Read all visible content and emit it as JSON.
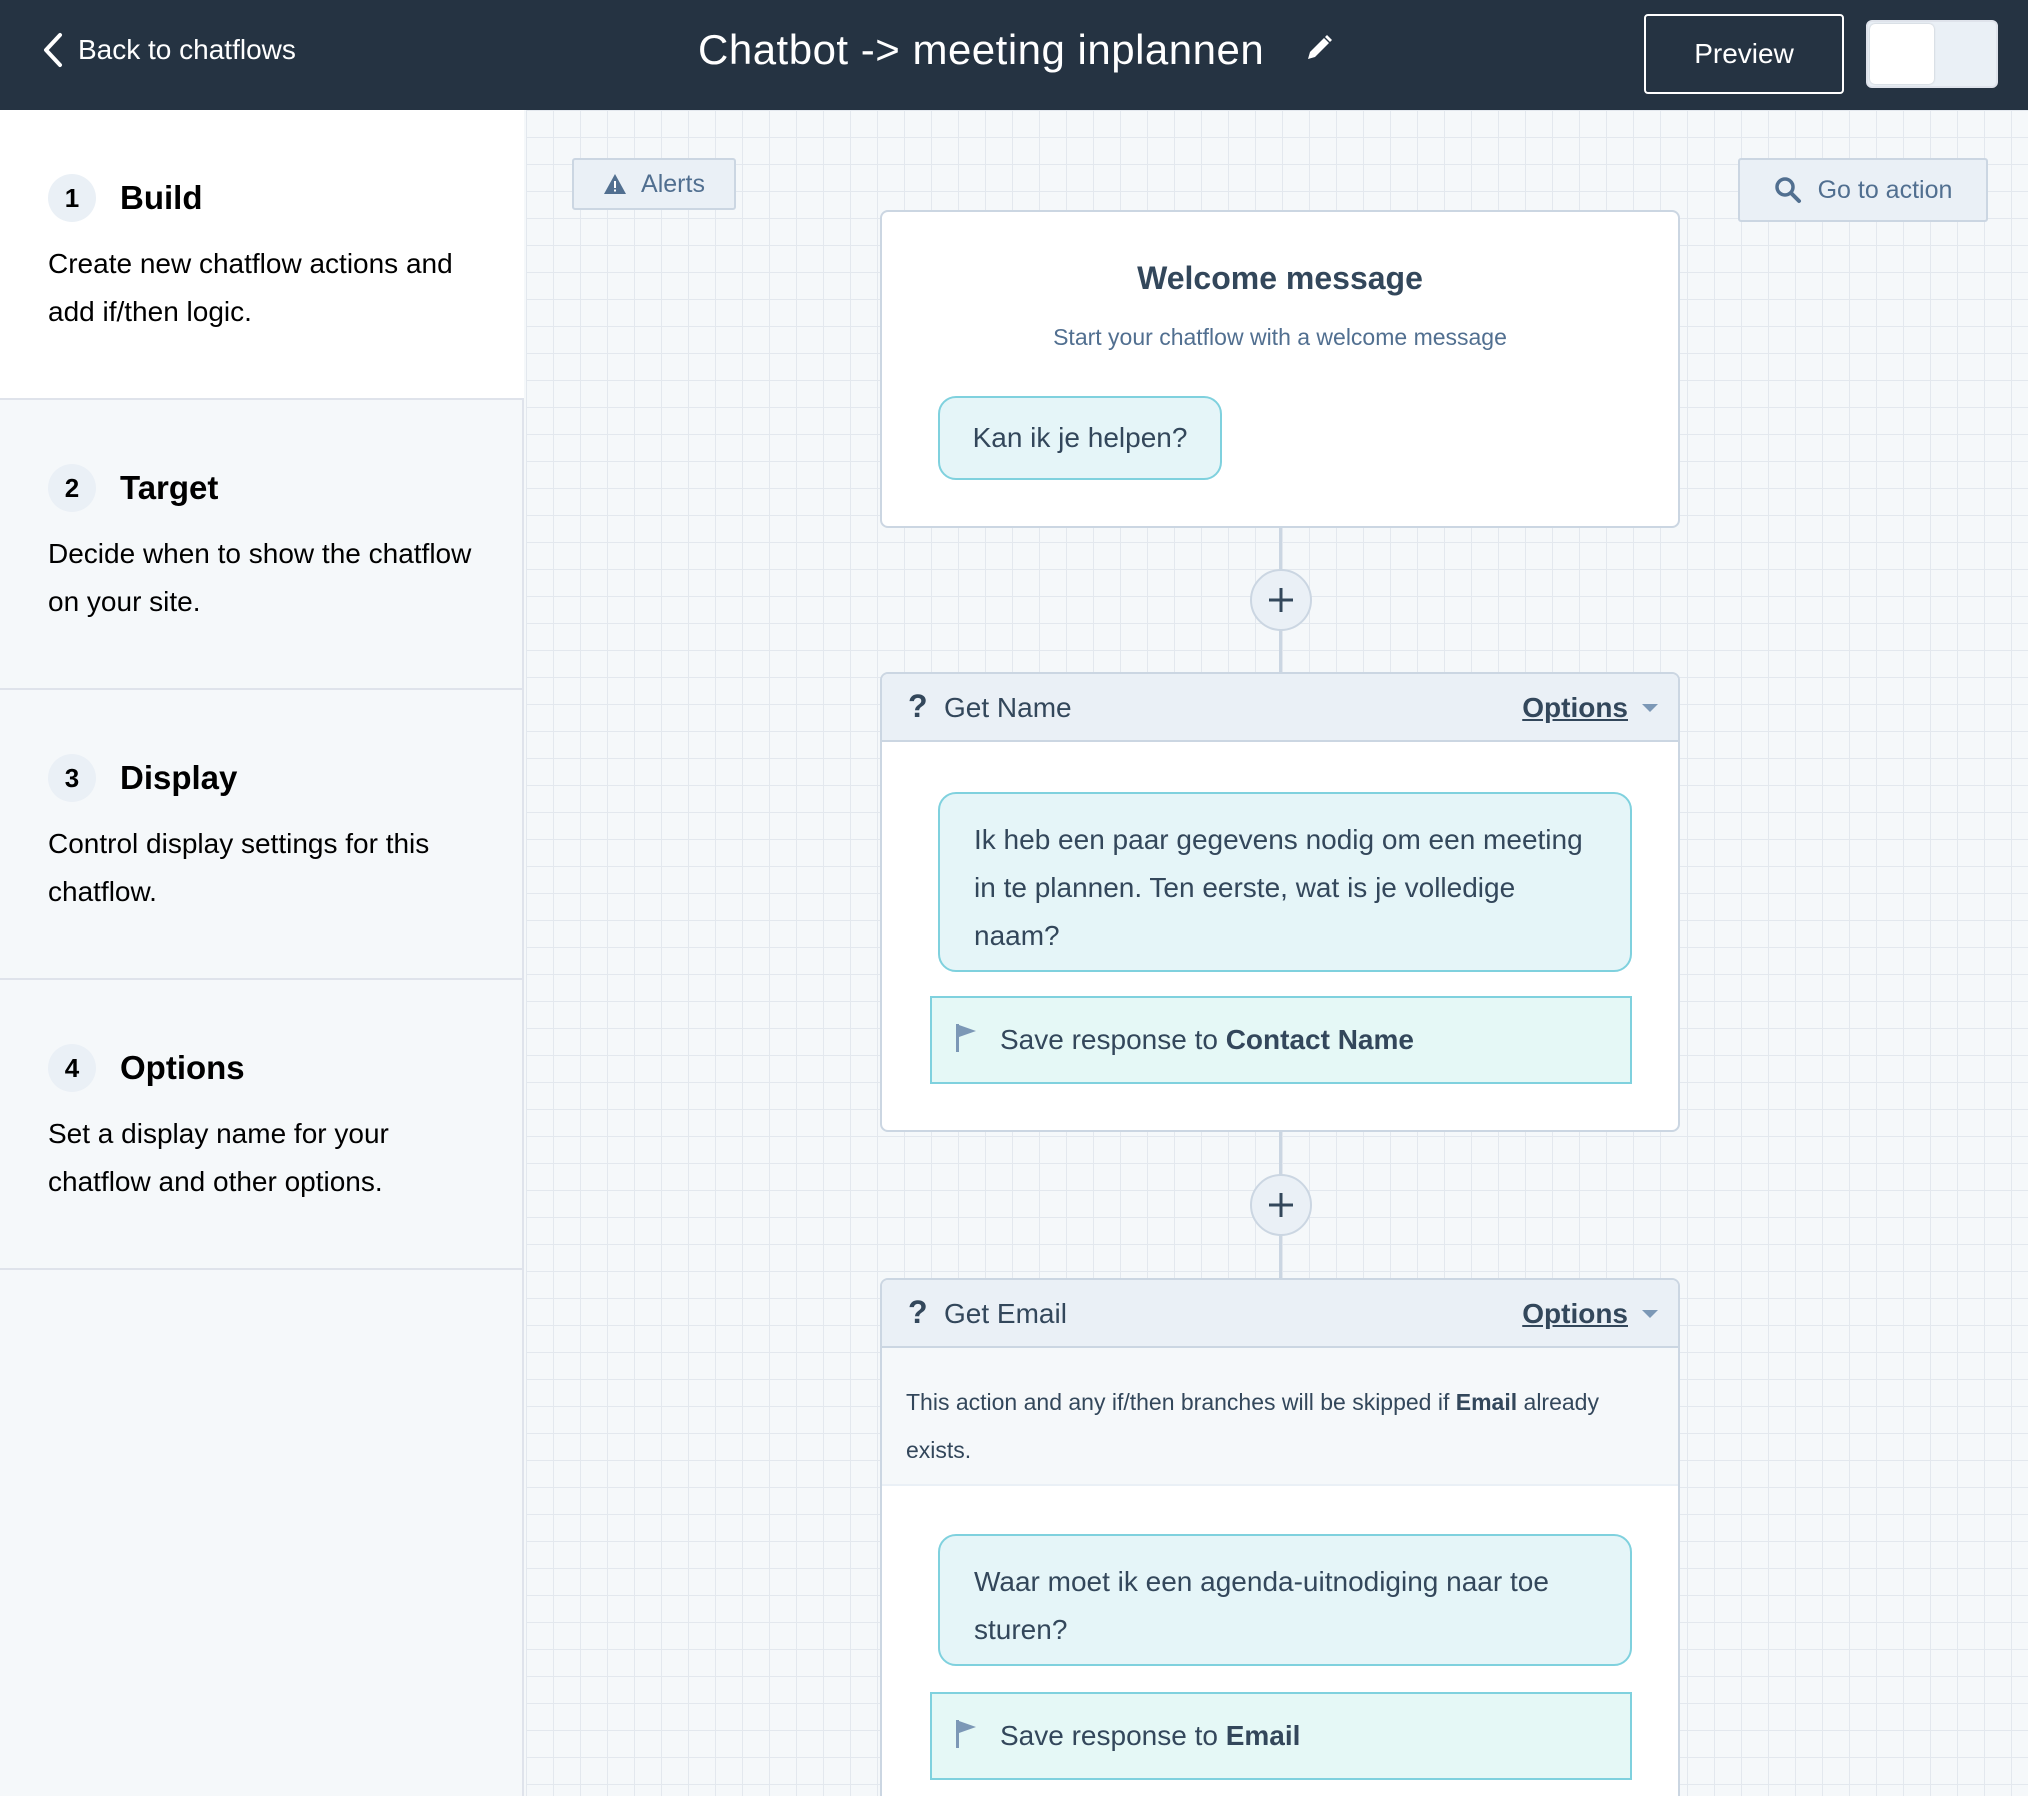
{
  "header": {
    "back_label": "Back to chatflows",
    "title": "Chatbot -> meeting inplannen",
    "preview_label": "Preview"
  },
  "colors": {
    "header_bg": "#253342",
    "accent_teal": "#7fd1de",
    "bubble_bg": "#e5f5f8",
    "save_bg": "#e5f8f6",
    "text": "#33475b"
  },
  "sidebar": {
    "steps": [
      {
        "num": "1",
        "title": "Build",
        "desc": "Create new chatflow actions and add if/then logic."
      },
      {
        "num": "2",
        "title": "Target",
        "desc": "Decide when to show the chatflow on your site."
      },
      {
        "num": "3",
        "title": "Display",
        "desc": "Control display settings for this chatflow."
      },
      {
        "num": "4",
        "title": "Options",
        "desc": "Set a display name for your chatflow and other options."
      }
    ]
  },
  "canvas": {
    "alerts_label": "Alerts",
    "goto_label": "Go to action",
    "welcome": {
      "title": "Welcome message",
      "subtitle": "Start your chatflow with a welcome message",
      "message": "Kan ik je helpen?"
    },
    "get_name": {
      "icon": "question-icon",
      "name": "Get Name",
      "options_label": "Options",
      "message": "Ik heb een paar gegevens nodig om een meeting in te plannen. Ten eerste, wat is je volledige naam?",
      "save_prefix": "Save response to",
      "save_property": "Contact Name"
    },
    "get_email": {
      "icon": "question-icon",
      "name": "Get Email",
      "options_label": "Options",
      "skip_prefix": "This action and any if/then branches will be skipped if",
      "skip_property": "Email",
      "skip_suffix": "already exists.",
      "message": "Waar moet ik een agenda-uitnodiging naar toe sturen?",
      "save_prefix": "Save response to",
      "save_property": "Email"
    }
  }
}
